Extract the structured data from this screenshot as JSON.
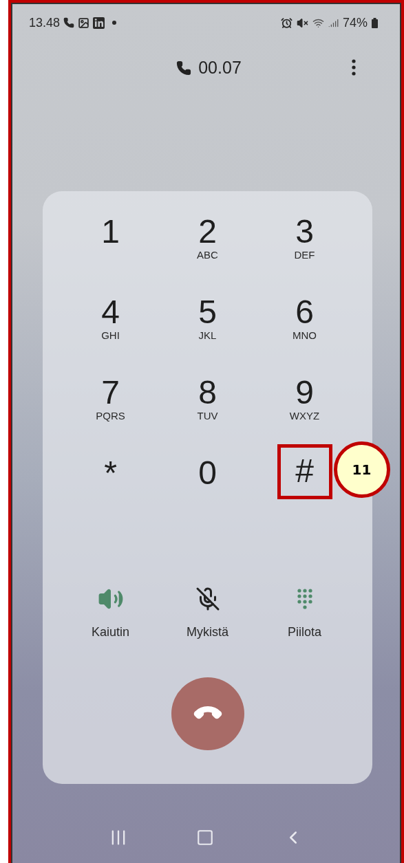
{
  "status_bar": {
    "time": "13.48",
    "battery": "74%"
  },
  "call": {
    "duration": "00.07"
  },
  "keypad": [
    {
      "digit": "1",
      "highlighted": false
    },
    {
      "digit": "2",
      "letters": "ABC",
      "highlighted": false
    },
    {
      "digit": "3",
      "letters": "DEF",
      "highlighted": false
    },
    {
      "digit": "4",
      "letters": "GHI",
      "highlighted": false
    },
    {
      "digit": "5",
      "letters": "JKL",
      "highlighted": false
    },
    {
      "digit": "6",
      "letters": "MNO",
      "highlighted": false
    },
    {
      "digit": "7",
      "letters": "PQRS",
      "highlighted": false
    },
    {
      "digit": "8",
      "letters": "TUV",
      "highlighted": false
    },
    {
      "digit": "9",
      "letters": "WXYZ",
      "highlighted": false
    },
    {
      "digit": "*",
      "highlighted": false
    },
    {
      "digit": "0",
      "highlighted": false
    },
    {
      "digit": "#",
      "highlighted": true,
      "callout": "11"
    }
  ],
  "actions": [
    {
      "kind": "speaker",
      "label": "Kaiutin"
    },
    {
      "kind": "mute",
      "label": "Mykistä"
    },
    {
      "kind": "hide",
      "label": "Piilota"
    }
  ]
}
